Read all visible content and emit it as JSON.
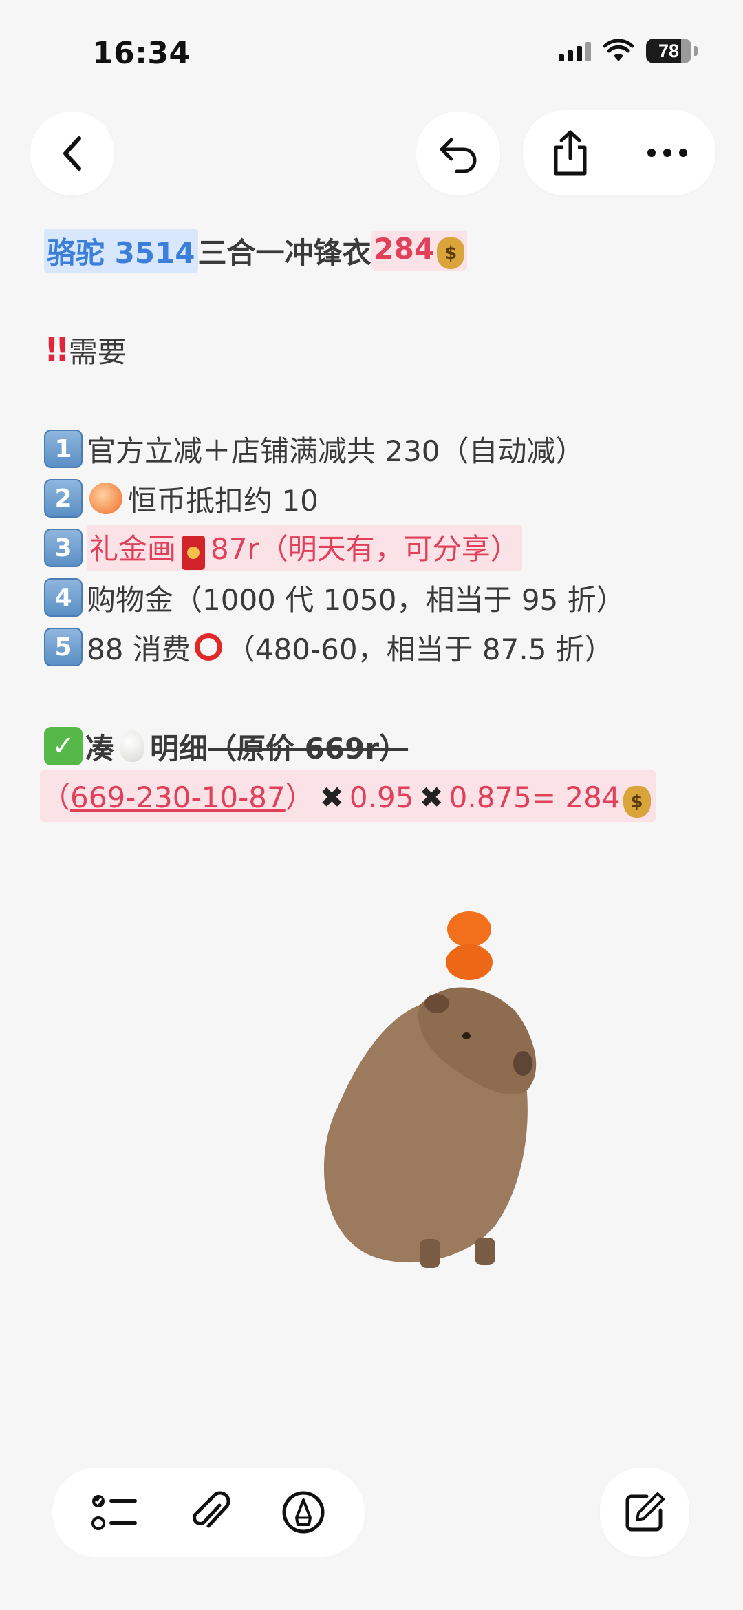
{
  "status_bar": {
    "time": "16:34",
    "battery": "78",
    "battery_level_percent": 78
  },
  "nav": {
    "back_icon": "chevron-left-icon",
    "undo_icon": "undo-icon",
    "share_icon": "share-icon",
    "more_icon": "more-icon"
  },
  "note": {
    "title": {
      "brand": "骆驼 3514",
      "product": "三合一冲锋衣",
      "price": "284"
    },
    "need_label": "需要",
    "items": [
      {
        "num": "1",
        "text": "官方立减＋店铺满减共 230（自动减）"
      },
      {
        "num": "2",
        "text": "恒币抵扣约 10"
      },
      {
        "num": "3",
        "text_a": "礼金画",
        "text_b": "87r（明天有，可分享）"
      },
      {
        "num": "4",
        "text": "购物金（1000 代 1050，相当于 95 折）"
      },
      {
        "num": "5",
        "text_a": "88 消费",
        "text_b": "（480-60，相当于 87.5 折）"
      }
    ],
    "detail": {
      "prefix": "凑",
      "label": "明细",
      "original": "（原价 669r）"
    },
    "formula": {
      "open": "（",
      "expr": "669-230-10-87",
      "close": "）",
      "x1": "✖",
      "f1": "0.95",
      "x2": "✖",
      "f2": "0.875= 284"
    }
  },
  "toolbar": {
    "checklist_icon": "checklist-icon",
    "attachment_icon": "paperclip-icon",
    "markup_icon": "pen-markup-icon",
    "compose_icon": "compose-icon"
  },
  "colors": {
    "blue_highlight": "#d8e7fb",
    "pink_highlight": "#fbe2e6",
    "accent_red": "#e0405a",
    "accent_blue": "#3b7fdb"
  }
}
